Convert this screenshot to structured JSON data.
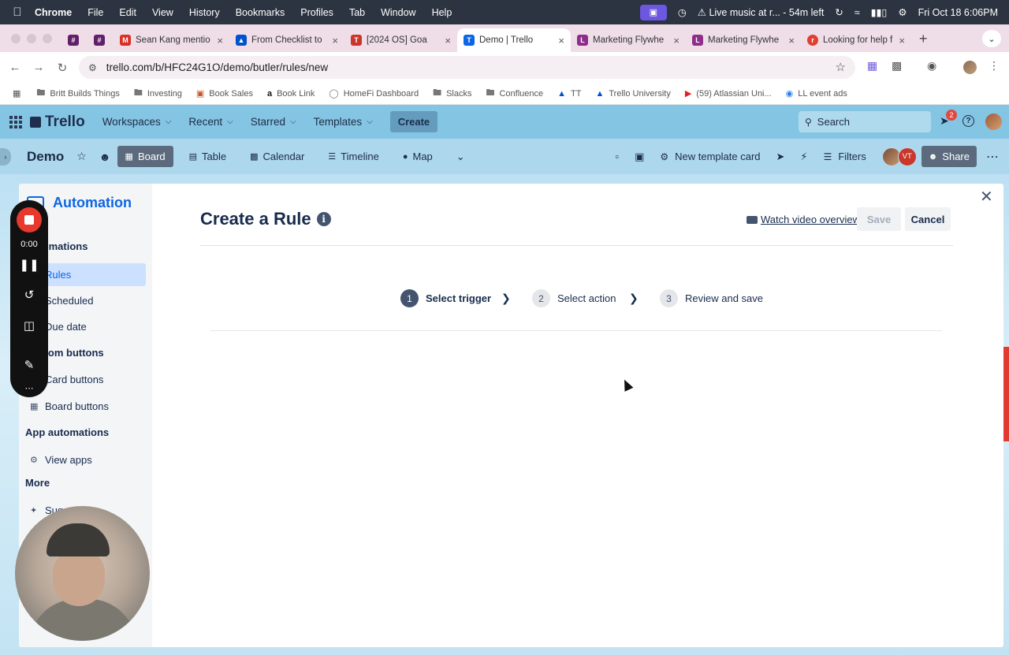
{
  "menubar": {
    "app": "Chrome",
    "items": [
      "File",
      "Edit",
      "View",
      "History",
      "Bookmarks",
      "Profiles",
      "Tab",
      "Window",
      "Help"
    ],
    "status_text": "Live music at r... - 54m left",
    "datetime": "Fri Oct 18  6:06PM"
  },
  "tabs": [
    {
      "title": "",
      "icon": "slack-icon",
      "color": "#611f69"
    },
    {
      "title": "",
      "icon": "slack-icon",
      "color": "#611f69"
    },
    {
      "title": "Sean Kang mentio",
      "icon": "gmail-icon",
      "color": "#d93025"
    },
    {
      "title": "From Checklist to",
      "icon": "atlassian-icon",
      "color": "#0052cc"
    },
    {
      "title": "[2024 OS] Goa",
      "icon": "trello-icon",
      "color": "#c9372c"
    },
    {
      "title": "Demo | Trello",
      "icon": "trello-icon",
      "color": "#0c66e4",
      "active": true
    },
    {
      "title": "Marketing Flywhe",
      "icon": "loom-icon",
      "color": "#8f2e8a"
    },
    {
      "title": "Marketing Flywhe",
      "icon": "loom-icon",
      "color": "#8f2e8a"
    },
    {
      "title": "Looking for help f",
      "icon": "reddit-icon",
      "color": "#e0402e"
    }
  ],
  "address": {
    "url": "trello.com/b/HFC24G1O/demo/butler/rules/new"
  },
  "bookmarks": [
    {
      "label": "Britt Builds Things",
      "icon": "folder-icon"
    },
    {
      "label": "Investing",
      "icon": "folder-icon"
    },
    {
      "label": "Book Sales",
      "icon": "book-icon"
    },
    {
      "label": "Book Link",
      "icon": "amazon-icon"
    },
    {
      "label": "HomeFi Dashboard",
      "icon": "globe-icon"
    },
    {
      "label": "Slacks",
      "icon": "folder-icon"
    },
    {
      "label": "Confluence",
      "icon": "folder-icon"
    },
    {
      "label": "TT",
      "icon": "atlassian-icon"
    },
    {
      "label": "Trello University",
      "icon": "atlassian-icon"
    },
    {
      "label": "(59) Atlassian Uni...",
      "icon": "youtube-icon"
    },
    {
      "label": "LL event ads",
      "icon": "ads-icon"
    }
  ],
  "trello_header": {
    "logo": "Trello",
    "nav": [
      "Workspaces",
      "Recent",
      "Starred",
      "Templates"
    ],
    "create": "Create",
    "search_placeholder": "Search",
    "notifications": "2"
  },
  "board_bar": {
    "name": "Demo",
    "views": [
      "Board",
      "Table",
      "Calendar",
      "Timeline",
      "Map"
    ],
    "active_view": "Board",
    "new_template_card": "New template card",
    "filters": "Filters",
    "member_initials": "VT",
    "share": "Share"
  },
  "automation": {
    "title": "Automation",
    "sections": [
      {
        "label": "Automations",
        "items": [
          "Rules",
          "Scheduled",
          "Due date"
        ]
      },
      {
        "label": "Custom buttons",
        "items": [
          "Card buttons",
          "Board buttons"
        ]
      },
      {
        "label": "App automations",
        "items": [
          "View apps"
        ]
      },
      {
        "label": "More",
        "items": [
          "Suggestions"
        ]
      }
    ],
    "active_item": "Rules"
  },
  "rule": {
    "title": "Create a Rule",
    "watch_video": "Watch video overview",
    "save": "Save",
    "cancel": "Cancel",
    "steps": [
      {
        "num": "1",
        "label": "Select trigger",
        "current": true
      },
      {
        "num": "2",
        "label": "Select action"
      },
      {
        "num": "3",
        "label": "Review and save"
      }
    ]
  },
  "recorder": {
    "time": "0:00"
  },
  "colors": {
    "accent": "#0c66e4",
    "record": "#e8392e"
  }
}
